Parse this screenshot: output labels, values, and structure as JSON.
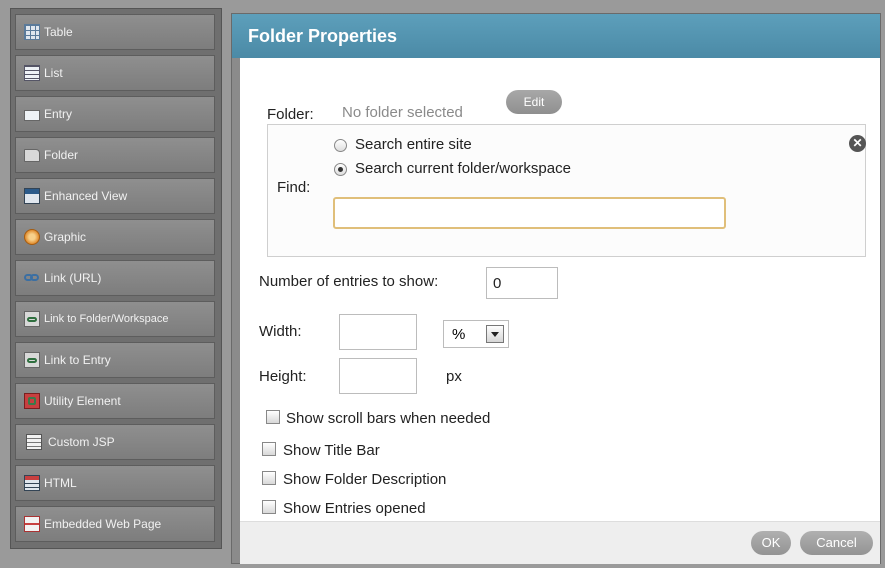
{
  "sidebar": {
    "items": [
      {
        "label": "Table",
        "icon": "table-icon"
      },
      {
        "label": "List",
        "icon": "list-icon"
      },
      {
        "label": "Entry",
        "icon": "entry-icon"
      },
      {
        "label": "Folder",
        "icon": "folder-icon"
      },
      {
        "label": "Enhanced View",
        "icon": "enhanced-view-icon"
      },
      {
        "label": "Graphic",
        "icon": "graphic-icon"
      },
      {
        "label": "Link (URL)",
        "icon": "link-icon"
      },
      {
        "label": "Link to Folder/Workspace",
        "icon": "link-folder-icon"
      },
      {
        "label": "Link to Entry",
        "icon": "link-entry-icon"
      },
      {
        "label": "Utility Element",
        "icon": "utility-element-icon"
      },
      {
        "label": "Custom JSP",
        "icon": "custom-jsp-icon"
      },
      {
        "label": "HTML",
        "icon": "html-icon"
      },
      {
        "label": "Embedded Web Page",
        "icon": "embedded-web-page-icon"
      }
    ]
  },
  "dialog": {
    "title": "Folder Properties",
    "folder": {
      "label": "Folder:",
      "value": "No folder selected",
      "edit_label": "Edit"
    },
    "find": {
      "label": "Find:",
      "options": [
        {
          "label": "Search entire site",
          "checked": false
        },
        {
          "label": "Search current folder/workspace",
          "checked": true
        }
      ],
      "query": ""
    },
    "entries": {
      "label": "Number of entries to show:",
      "value": "0"
    },
    "width": {
      "label": "Width:",
      "value": "",
      "unit": "%"
    },
    "height": {
      "label": "Height:",
      "value": "",
      "unit": "px"
    },
    "checkboxes": [
      {
        "label": "Show scroll bars when needed",
        "checked": false
      },
      {
        "label": "Show Title Bar",
        "checked": false
      },
      {
        "label": "Show Folder Description",
        "checked": false
      },
      {
        "label": "Show Entries opened",
        "checked": false
      }
    ],
    "ok_label": "OK",
    "cancel_label": "Cancel"
  },
  "colors": {
    "title_bar": "#4b8aa6",
    "sidebar_bg": "#7d7d7d",
    "input_focus_border": "#e0bf7a"
  }
}
